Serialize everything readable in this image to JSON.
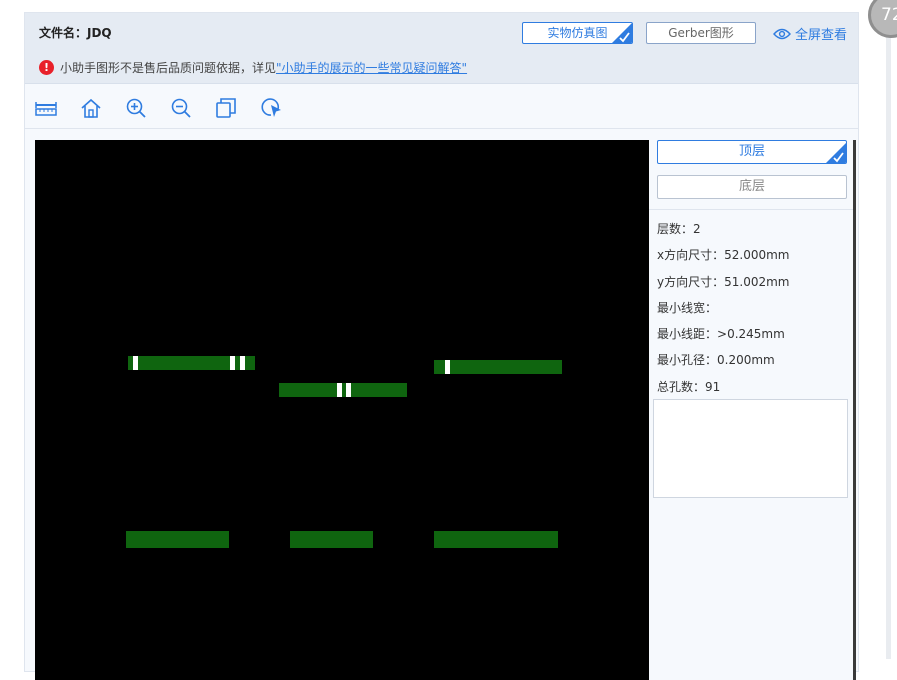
{
  "header": {
    "file_label": "文件名：JDQ",
    "btn_real": "实物仿真图",
    "btn_gerber": "Gerber图形",
    "fullscreen": "全屏查看"
  },
  "notice": {
    "text": "小助手图形不是售后品质问题依据，详见",
    "link": "\"小助手的展示的一些常见疑问解答\""
  },
  "toolbar": {
    "icons": [
      "ruler-icon",
      "home-icon",
      "zoom-in-icon",
      "zoom-out-icon",
      "copy-icon",
      "pointer-icon"
    ]
  },
  "layers": {
    "top": "顶层",
    "bottom": "底层",
    "active": "top"
  },
  "info": {
    "layers_label": "层数：",
    "layers_value": "2",
    "x_label": "x方向尺寸：",
    "x_value": "52.000mm",
    "y_label": "y方向尺寸：",
    "y_value": "51.002mm",
    "min_width_label": "最小线宽：",
    "min_width_value": "",
    "min_spacing_label": "最小线距：",
    "min_spacing_value": ">0.245mm",
    "min_hole_label": "最小孔径：",
    "min_hole_value": "0.200mm",
    "hole_count_label": "总孔数：",
    "hole_count_value": "91"
  },
  "badge": {
    "text": "72"
  },
  "colors": {
    "accent": "#2f7ce0",
    "copper": "#0f650f",
    "board_bg": "#000000",
    "warning": "#e8212a"
  }
}
